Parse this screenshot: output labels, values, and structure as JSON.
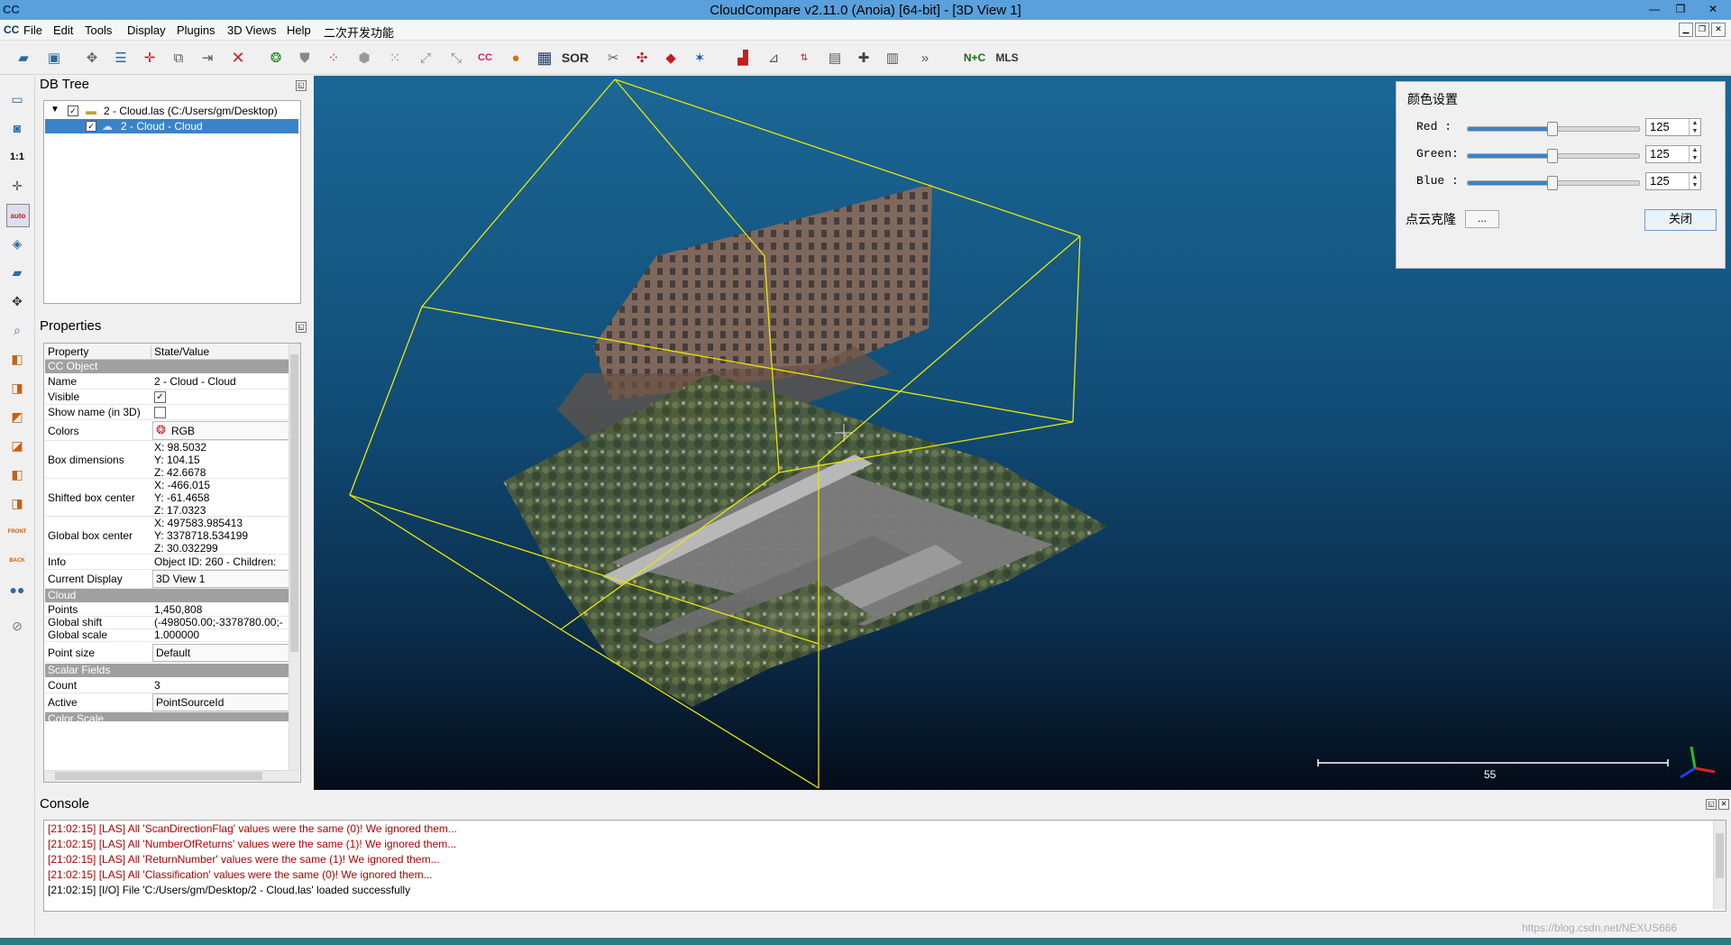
{
  "window": {
    "title": "CloudCompare v2.11.0 (Anoia) [64-bit] - [3D View 1]",
    "app_icon": "CC"
  },
  "menu": [
    "File",
    "Edit",
    "Tools",
    "Display",
    "Plugins",
    "3D Views",
    "Help",
    "二次开发功能"
  ],
  "toolbar_text": {
    "ccc": "CC",
    "sor": "SOR",
    "more": "»",
    "nc": "N+C",
    "mls": "MLS"
  },
  "left_toolbar_text": {
    "one_to_one": "1:1",
    "auto": "auto",
    "front": "FRONT",
    "back": "BACK"
  },
  "db_tree": {
    "title": "DB Tree",
    "items": [
      {
        "label": "2 - Cloud.las (C:/Users/gm/Desktop)",
        "checked": true
      },
      {
        "label": "2 - Cloud - Cloud",
        "checked": true
      }
    ]
  },
  "properties": {
    "title": "Properties",
    "header": {
      "property": "Property",
      "value": "State/Value"
    },
    "sections": {
      "cc_object": "CC Object",
      "cloud": "Cloud",
      "scalar_fields": "Scalar Fields",
      "color_scale": "Color Scale"
    },
    "rows": {
      "name": [
        "Name",
        "2 - Cloud - Cloud"
      ],
      "visible": [
        "Visible",
        "✓"
      ],
      "show_name": [
        "Show name (in 3D)",
        ""
      ],
      "colors": [
        "Colors",
        "RGB"
      ],
      "box_dimensions": [
        "Box dimensions",
        "X: 98.5032",
        "Y: 104.15",
        "Z: 42.6678"
      ],
      "shifted_box_center": [
        "Shifted box center",
        "X: -466.015",
        "Y: -61.4658",
        "Z: 17.0323"
      ],
      "global_box_center": [
        "Global box center",
        "X: 497583.985413",
        "Y: 3378718.534199",
        "Z: 30.032299"
      ],
      "info": [
        "Info",
        "Object ID: 260 - Children:"
      ],
      "current_display": [
        "Current Display",
        "3D View 1"
      ],
      "points": [
        "Points",
        "1,450,808"
      ],
      "global_shift": [
        "Global shift",
        "(-498050.00;-3378780.00;-"
      ],
      "global_scale": [
        "Global scale",
        "1.000000"
      ],
      "point_size": [
        "Point size",
        "Default"
      ],
      "count": [
        "Count",
        "3"
      ],
      "active": [
        "Active",
        "PointSourceId"
      ]
    }
  },
  "color_panel": {
    "title": "颜色设置",
    "red": {
      "label": "Red  :",
      "value": "125",
      "level": 0.49
    },
    "green": {
      "label": "Green:",
      "value": "125",
      "level": 0.49
    },
    "blue": {
      "label": "Blue :",
      "value": "125",
      "level": 0.49
    },
    "clone_label": "点云克隆",
    "clone_button": "...",
    "close_button": "关闭"
  },
  "view": {
    "scale_value": "55"
  },
  "console": {
    "title": "Console",
    "lines": [
      {
        "text": "[21:02:15] [LAS] All 'ScanDirectionFlag' values were the same (0)! We ignored them...",
        "color": "#b00000"
      },
      {
        "text": "[21:02:15] [LAS] All 'NumberOfReturns' values were the same (1)! We ignored them...",
        "color": "#b00000"
      },
      {
        "text": "[21:02:15] [LAS] All 'ReturnNumber' values were the same (1)! We ignored them...",
        "color": "#b00000"
      },
      {
        "text": "[21:02:15] [LAS] All 'Classification' values were the same (0)! We ignored them...",
        "color": "#b00000"
      },
      {
        "text": "[21:02:15] [I/O] File 'C:/Users/gm/Desktop/2 - Cloud.las' loaded successfully",
        "color": "#000000"
      }
    ]
  },
  "watermark": "https://blog.csdn.net/NEXUS666",
  "colors": {
    "titlebar": "#5aa0dc",
    "selection": "#3b83c8",
    "bbox": "#e8e800",
    "section": "#a0a0a0"
  }
}
